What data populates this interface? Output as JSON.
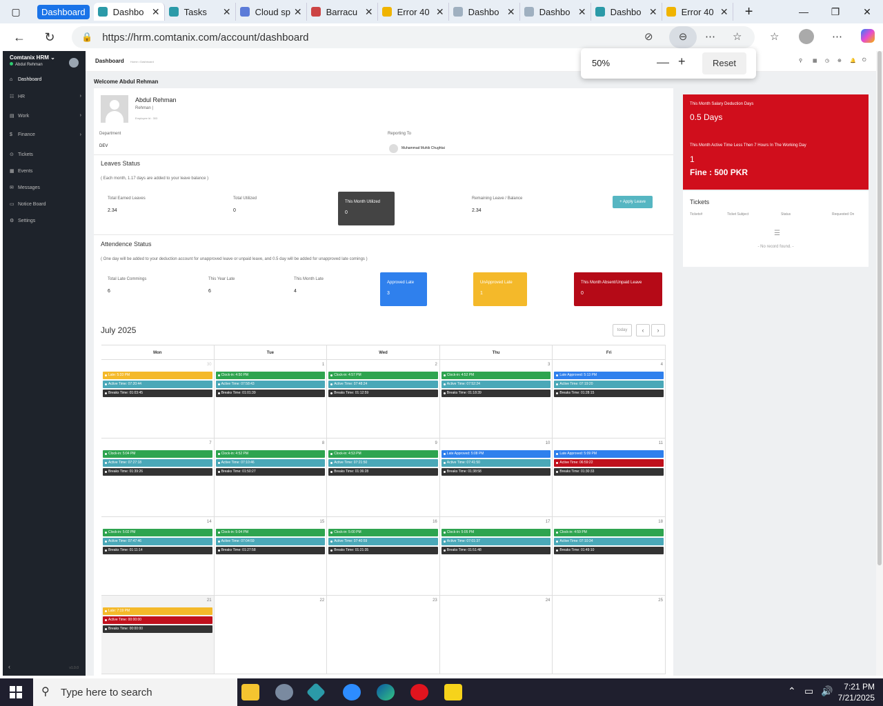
{
  "browser": {
    "tab_group": "Dashboard",
    "tabs": [
      {
        "label": "Dashbo",
        "color": "#2b9aa8",
        "active": true
      },
      {
        "label": "Tasks",
        "color": "#2b9aa8"
      },
      {
        "label": "Cloud sp",
        "color": "#5b7bd8"
      },
      {
        "label": "Barracu",
        "color": "#c44"
      },
      {
        "label": "Error 40",
        "color": "#f0b400"
      },
      {
        "label": "Dashbo",
        "color": "#9fb0c0"
      },
      {
        "label": "Dashbo",
        "color": "#9fb0c0"
      },
      {
        "label": "Dashbo",
        "color": "#2b9aa8"
      },
      {
        "label": "Error 40",
        "color": "#f0b400"
      }
    ],
    "url": "https://hrm.comtanix.com/account/dashboard",
    "zoom": {
      "value": "50%",
      "reset_label": "Reset"
    }
  },
  "sidebar": {
    "brand": "Comtanix HRM",
    "user": "Abdul Rehman",
    "items": [
      {
        "label": "Dashboard",
        "icon": "home-icon"
      },
      {
        "label": "HR",
        "icon": "users-icon"
      },
      {
        "label": "Work",
        "icon": "briefcase-icon"
      },
      {
        "label": "Finance",
        "icon": "dollar-icon"
      },
      {
        "label": "Tickets",
        "icon": "ticket-icon"
      },
      {
        "label": "Events",
        "icon": "calendar-icon"
      },
      {
        "label": "Messages",
        "icon": "message-icon"
      },
      {
        "label": "Notice Board",
        "icon": "notice-icon"
      },
      {
        "label": "Settings",
        "icon": "gear-icon"
      }
    ],
    "version": "v1.0.0"
  },
  "header": {
    "title": "Dashboard",
    "breadcrumb": "Home • Dashboard"
  },
  "welcome": "Welcome Abdul Rehman",
  "profile": {
    "name": "Abdul Rehman",
    "sub": "Rehman |",
    "emp_id": "Employee Id : 303",
    "department_label": "Department",
    "department": "DEV",
    "reporting_label": "Reporting To",
    "reporting": "Muhammad Muhib Chughtai"
  },
  "leaves": {
    "title": "Leaves Status",
    "note": "( Each month, 1.17 days are added to your leave balance )",
    "earned_label": "Total Earned Leaves",
    "earned": "2.34",
    "utilized_label": "Total Utilized",
    "utilized": "0",
    "month_label": "This Month Utilized",
    "month": "0",
    "remaining_label": "Remaining Leave / Balance",
    "remaining": "2.34",
    "apply": "+ Apply Leave"
  },
  "attendance": {
    "title": "Attendence Status",
    "note": "( One day will be added to your deduction account for unapproved leave or unpaid leave, and 0.5 day will be added for unapproved late comings )",
    "late_label": "Total Late Commings",
    "late": "6",
    "year_label": "This Year Late",
    "year": "6",
    "month_label": "This Month Late",
    "month": "4",
    "approved_label": "Approved Late",
    "approved": "3",
    "unapproved_label": "UnApproved Late",
    "unapproved": "1",
    "absent_label": "This Month Absent/Unpaid Leave",
    "absent": "0"
  },
  "right": {
    "deduction_label": "This Month Salary Deduction Days",
    "deduction": "0.5 Days",
    "less_label": "This Month Active Time Less Then 7 Hours In The Working Day",
    "less": "1",
    "fine": "Fine : 500 PKR",
    "tickets_title": "Tickets",
    "ticket_cols": [
      "Tickets#",
      "Ticket Subject",
      "Status",
      "Requested On"
    ],
    "no_record": "- No record found. -"
  },
  "calendar": {
    "title": "July 2025",
    "today_label": "today",
    "days": [
      "Mon",
      "Tue",
      "Wed",
      "Thu",
      "Fri"
    ],
    "weeks": [
      [
        {
          "d": "30",
          "muted": true,
          "ev": [
            [
              "Late: 5:33 PM",
              "#f4b92a"
            ],
            [
              "Active Time: 07:20:44",
              "#4aa8b8"
            ],
            [
              "Breaks Time: 01:03:45",
              "#333"
            ]
          ]
        },
        {
          "d": "1",
          "ev": [
            [
              "Clock-in: 4:50 PM",
              "#2ea44f"
            ],
            [
              "Active Time: 07:58:43",
              "#4aa8b8"
            ],
            [
              "Breaks Time: 01:01:39",
              "#333"
            ]
          ]
        },
        {
          "d": "2",
          "ev": [
            [
              "Clock-in: 4:57 PM",
              "#2ea44f"
            ],
            [
              "Active Time: 07:48:24",
              "#4aa8b8"
            ],
            [
              "Breaks Time: 01:12:59",
              "#333"
            ]
          ]
        },
        {
          "d": "3",
          "ev": [
            [
              "Clock-in: 4:52 PM",
              "#2ea44f"
            ],
            [
              "Active Time: 07:52:24",
              "#4aa8b8"
            ],
            [
              "Breaks Time: 01:18:39",
              "#333"
            ]
          ]
        },
        {
          "d": "4",
          "ev": [
            [
              "Late Approved: 5:13 PM",
              "#2f80ed"
            ],
            [
              "Active Time: 07:19:20",
              "#4aa8b8"
            ],
            [
              "Breaks Time: 01:28:15",
              "#333"
            ]
          ]
        }
      ],
      [
        {
          "d": "7",
          "ev": [
            [
              "Clock-in: 5:04 PM",
              "#2ea44f"
            ],
            [
              "Active Time: 07:27:18",
              "#4aa8b8"
            ],
            [
              "Breaks Time: 01:39:26",
              "#333"
            ]
          ]
        },
        {
          "d": "8",
          "ev": [
            [
              "Clock-in: 4:52 PM",
              "#2ea44f"
            ],
            [
              "Active Time: 07:10:46",
              "#4aa8b8"
            ],
            [
              "Breaks Time: 01:50:27",
              "#333"
            ]
          ]
        },
        {
          "d": "9",
          "ev": [
            [
              "Clock-in: 4:53 PM",
              "#2ea44f"
            ],
            [
              "Active Time: 07:21:50",
              "#4aa8b8"
            ],
            [
              "Breaks Time: 01:36:28",
              "#333"
            ]
          ]
        },
        {
          "d": "10",
          "ev": [
            [
              "Late Approved: 5:08 PM",
              "#2f80ed"
            ],
            [
              "Active Time: 07:41:50",
              "#4aa8b8"
            ],
            [
              "Breaks Time: 01:38:58",
              "#333"
            ]
          ]
        },
        {
          "d": "11",
          "ev": [
            [
              "Late Approved: 5:09 PM",
              "#2f80ed"
            ],
            [
              "Active Time: 06:59:22",
              "#c0101c"
            ],
            [
              "Breaks Time: 01:30:33",
              "#333"
            ]
          ]
        }
      ],
      [
        {
          "d": "14",
          "ev": [
            [
              "Clock-in: 5:02 PM",
              "#2ea44f"
            ],
            [
              "Active Time: 07:47:46",
              "#4aa8b8"
            ],
            [
              "Breaks Time: 01:11:14",
              "#333"
            ]
          ]
        },
        {
          "d": "15",
          "ev": [
            [
              "Clock-in: 5:04 PM",
              "#2ea44f"
            ],
            [
              "Active Time: 07:04:59",
              "#4aa8b8"
            ],
            [
              "Breaks Time: 01:27:58",
              "#333"
            ]
          ]
        },
        {
          "d": "16",
          "ev": [
            [
              "Clock-in: 5:00 PM",
              "#2ea44f"
            ],
            [
              "Active Time: 07:40:59",
              "#4aa8b8"
            ],
            [
              "Breaks Time: 01:21:35",
              "#333"
            ]
          ]
        },
        {
          "d": "17",
          "ev": [
            [
              "Clock-in: 5:05 PM",
              "#2ea44f"
            ],
            [
              "Active Time: 07:01:37",
              "#4aa8b8"
            ],
            [
              "Breaks Time: 01:51:48",
              "#333"
            ]
          ]
        },
        {
          "d": "18",
          "ev": [
            [
              "Clock-in: 4:59 PM",
              "#2ea44f"
            ],
            [
              "Active Time: 07:10:34",
              "#4aa8b8"
            ],
            [
              "Breaks Time: 01:49:10",
              "#333"
            ]
          ]
        }
      ],
      [
        {
          "d": "21",
          "today": true,
          "ev": [
            [
              "Late: 7:19 PM",
              "#f4b92a"
            ],
            [
              "Active Time: 00:00:00",
              "#c0101c"
            ],
            [
              "Breaks Time: 00:00:00",
              "#333"
            ]
          ]
        },
        {
          "d": "22",
          "ev": []
        },
        {
          "d": "23",
          "ev": []
        },
        {
          "d": "24",
          "ev": []
        },
        {
          "d": "25",
          "ev": []
        }
      ]
    ]
  },
  "taskbar": {
    "search": "Type here to search",
    "time": "7:21 PM",
    "date": "7/21/2025"
  }
}
